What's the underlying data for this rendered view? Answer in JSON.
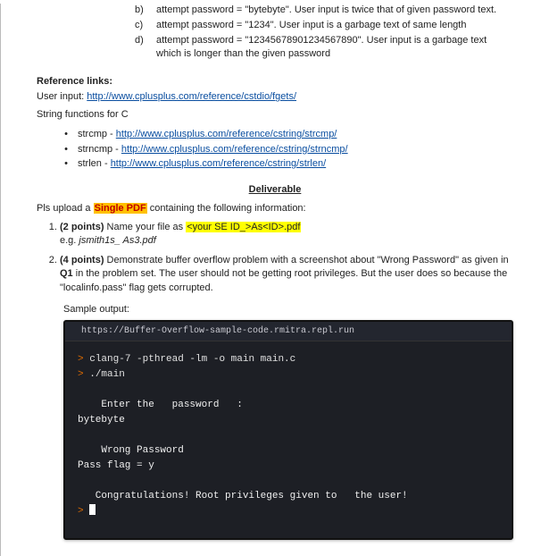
{
  "sub_items": [
    {
      "label": "b)",
      "text": "attempt password = \"bytebyte\". User input is twice that of given password text."
    },
    {
      "label": "c)",
      "text": "attempt password = \"1234\". User input is a garbage text of same length"
    },
    {
      "label": "d)",
      "text": "attempt password = \"12345678901234567890\". User input is a garbage text which is longer than the given password"
    }
  ],
  "ref_heading": "Reference links:",
  "user_input_label": "User input: ",
  "user_input_href": "http://www.cplusplus.com/reference/cstdio/fgets/",
  "string_funcs_label": "String functions for C",
  "func_links": [
    {
      "name": "strcmp",
      "href": "http://www.cplusplus.com/reference/cstring/strcmp/"
    },
    {
      "name": "strncmp",
      "href": "http://www.cplusplus.com/reference/cstring/strncmp/"
    },
    {
      "name": "strlen",
      "href": "http://www.cplusplus.com/reference/cstring/strlen/"
    }
  ],
  "deliverable_heading": "Deliverable",
  "pls_upload_pre": "Pls upload a ",
  "single_pdf": "Single PDF",
  "pls_upload_post": " containing the following information:",
  "item1": {
    "points": "(2 points)",
    "pre": " Name your file as ",
    "mask": "<your SE ID_>As<ID>.pdf",
    "eg_label": "e.g. ",
    "eg_value": "jsmith1s_ As3.pdf"
  },
  "item2": {
    "points": "(4 points)",
    "text": " Demonstrate buffer overflow problem with a screenshot about \"Wrong Password\" as given in ",
    "q1": "Q1",
    "text2": " in the problem set. The user should not be getting root privileges. But the user does so because the \"localinfo.pass\" flag gets corrupted."
  },
  "sample_output_label": "Sample output:",
  "terminal": {
    "title": "https://Buffer-Overflow-sample-code.rmitra.repl.run",
    "line1_cmd": "clang-7 -pthread -lm -o main main.c",
    "line2_cmd": "./main",
    "line4": "    Enter the   password   :",
    "line5": "bytebyte",
    "line7": "    Wrong Password",
    "line8": "Pass flag = y",
    "line10": "   Congratulations! Root privileges given to   the user!"
  }
}
